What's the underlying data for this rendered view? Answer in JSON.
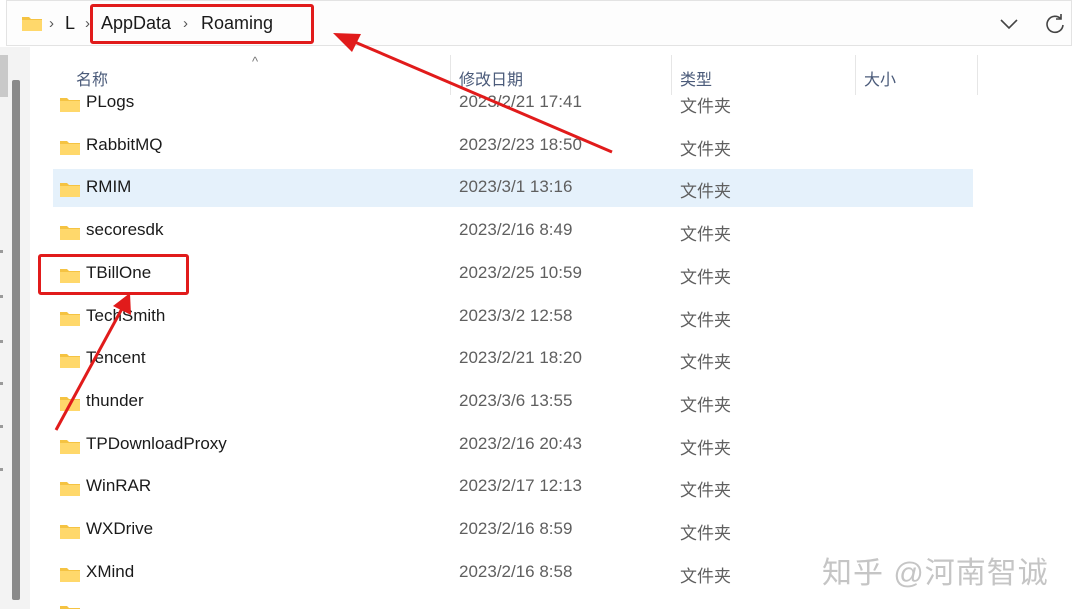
{
  "breadcrumb": {
    "root_label": "L",
    "appdata_label": "AppData",
    "roaming_label": "Roaming"
  },
  "columns": {
    "name": "名称",
    "modified": "修改日期",
    "type": "类型",
    "size": "大小"
  },
  "rows": [
    {
      "name": "PLogs",
      "date": "2023/2/21 17:41",
      "type": "文件夹"
    },
    {
      "name": "RabbitMQ",
      "date": "2023/2/23 18:50",
      "type": "文件夹"
    },
    {
      "name": "RMIM",
      "date": "2023/3/1 13:16",
      "type": "文件夹"
    },
    {
      "name": "secoresdk",
      "date": "2023/2/16 8:49",
      "type": "文件夹"
    },
    {
      "name": "TBillOne",
      "date": "2023/2/25 10:59",
      "type": "文件夹"
    },
    {
      "name": "TechSmith",
      "date": "2023/3/2 12:58",
      "type": "文件夹"
    },
    {
      "name": "Tencent",
      "date": "2023/2/21 18:20",
      "type": "文件夹"
    },
    {
      "name": "thunder",
      "date": "2023/3/6 13:55",
      "type": "文件夹"
    },
    {
      "name": "TPDownloadProxy",
      "date": "2023/2/16 20:43",
      "type": "文件夹"
    },
    {
      "name": "WinRAR",
      "date": "2023/2/17 12:13",
      "type": "文件夹"
    },
    {
      "name": "WXDrive",
      "date": "2023/2/16 8:59",
      "type": "文件夹"
    },
    {
      "name": "XMind",
      "date": "2023/2/16 8:58",
      "type": "文件夹"
    }
  ],
  "selected_row": "RMIM",
  "watermark": "知乎 @河南智诚",
  "colors": {
    "selection": "#e5f1fb",
    "annotation": "#e11b1b",
    "folder": "#f5c342"
  }
}
